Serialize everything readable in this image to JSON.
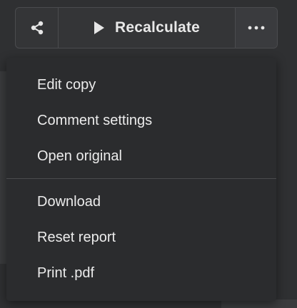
{
  "toolbar": {
    "share_icon": "share-icon",
    "recalculate_label": "Recalculate",
    "play_icon": "play-icon",
    "more_icon": "more-horizontal-icon"
  },
  "menu": {
    "group1": [
      {
        "label": "Edit copy"
      },
      {
        "label": "Comment settings"
      },
      {
        "label": "Open original"
      }
    ],
    "group2": [
      {
        "label": "Download"
      },
      {
        "label": "Reset report"
      },
      {
        "label": "Print .pdf"
      }
    ]
  },
  "colors": {
    "background": "#2f3032",
    "menu_background": "#2b2c2e",
    "text": "#ececec",
    "border": "#4a4b4e"
  }
}
